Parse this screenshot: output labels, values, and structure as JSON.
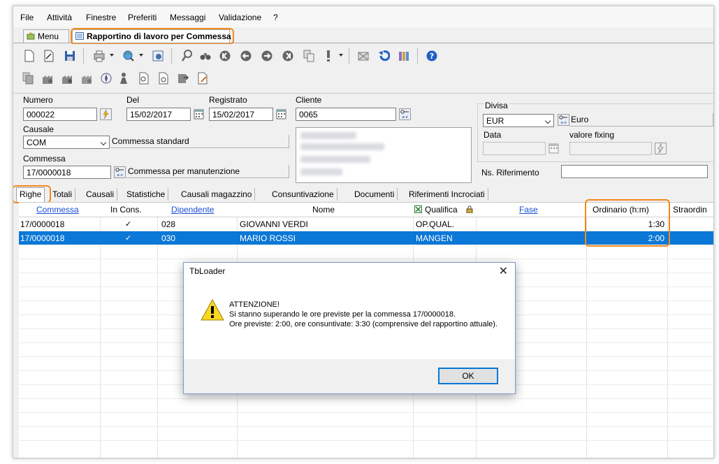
{
  "menu": [
    "File",
    "Attività",
    "Finestre",
    "Preferiti",
    "Messaggi",
    "Validazione",
    "?"
  ],
  "doc_tabs": {
    "menu": "Menu",
    "active": "Rapportino di lavoro per Commessa"
  },
  "form": {
    "numero_label": "Numero",
    "numero": "000022",
    "del_label": "Del",
    "del": "15/02/2017",
    "registrato_label": "Registrato",
    "registrato": "15/02/2017",
    "cliente_label": "Cliente",
    "cliente": "0065",
    "divisa_label": "Divisa",
    "divisa": "EUR",
    "divisa_desc": "Euro",
    "causale_label": "Causale",
    "causale": "COM",
    "causale_desc": "Commessa standard",
    "data_label": "Data",
    "fixing_label": "valore fixing",
    "commessa_label": "Commessa",
    "commessa": "17/0000018",
    "commessa_desc": "Commessa per manutenzione",
    "ns_rif_label": "Ns. Riferimento"
  },
  "grid_tabs": [
    "Righe",
    "Totali",
    "Causali",
    "Statistiche",
    "Causali magazzino",
    "Consuntivazione",
    "Documenti",
    "Riferimenti Incrociati"
  ],
  "columns": {
    "commessa": "Commessa",
    "in_cons": "In Cons.",
    "dipendente": "Dipendente",
    "nome": "Nome",
    "qualifica": "Qualifica",
    "fase": "Fase",
    "ordinario": "Ordinario (h:m)",
    "straordinario": "Straordin"
  },
  "rows": [
    {
      "commessa": "17/0000018",
      "in_cons": "✓",
      "dipendente": "028",
      "nome": "GIOVANNI VERDI",
      "qualifica": "OP.QUAL.",
      "ordinario": "1:30"
    },
    {
      "commessa": "17/0000018",
      "in_cons": "✓",
      "dipendente": "030",
      "nome": "MARIO ROSSI",
      "qualifica": "MANGEN",
      "ordinario": "2:00"
    }
  ],
  "dialog": {
    "title": "TbLoader",
    "heading": "ATTENZIONE!",
    "line1": "Si stanno superando le ore previste per la commessa 17/0000018.",
    "line2": "Ore previste: 2:00, ore consuntivate: 3:30 (comprensive del rapportino attuale).",
    "ok": "OK"
  },
  "colors": {
    "accent_highlight": "#f28a1b",
    "selection": "#0b78d7",
    "link": "#1a4fd6"
  }
}
